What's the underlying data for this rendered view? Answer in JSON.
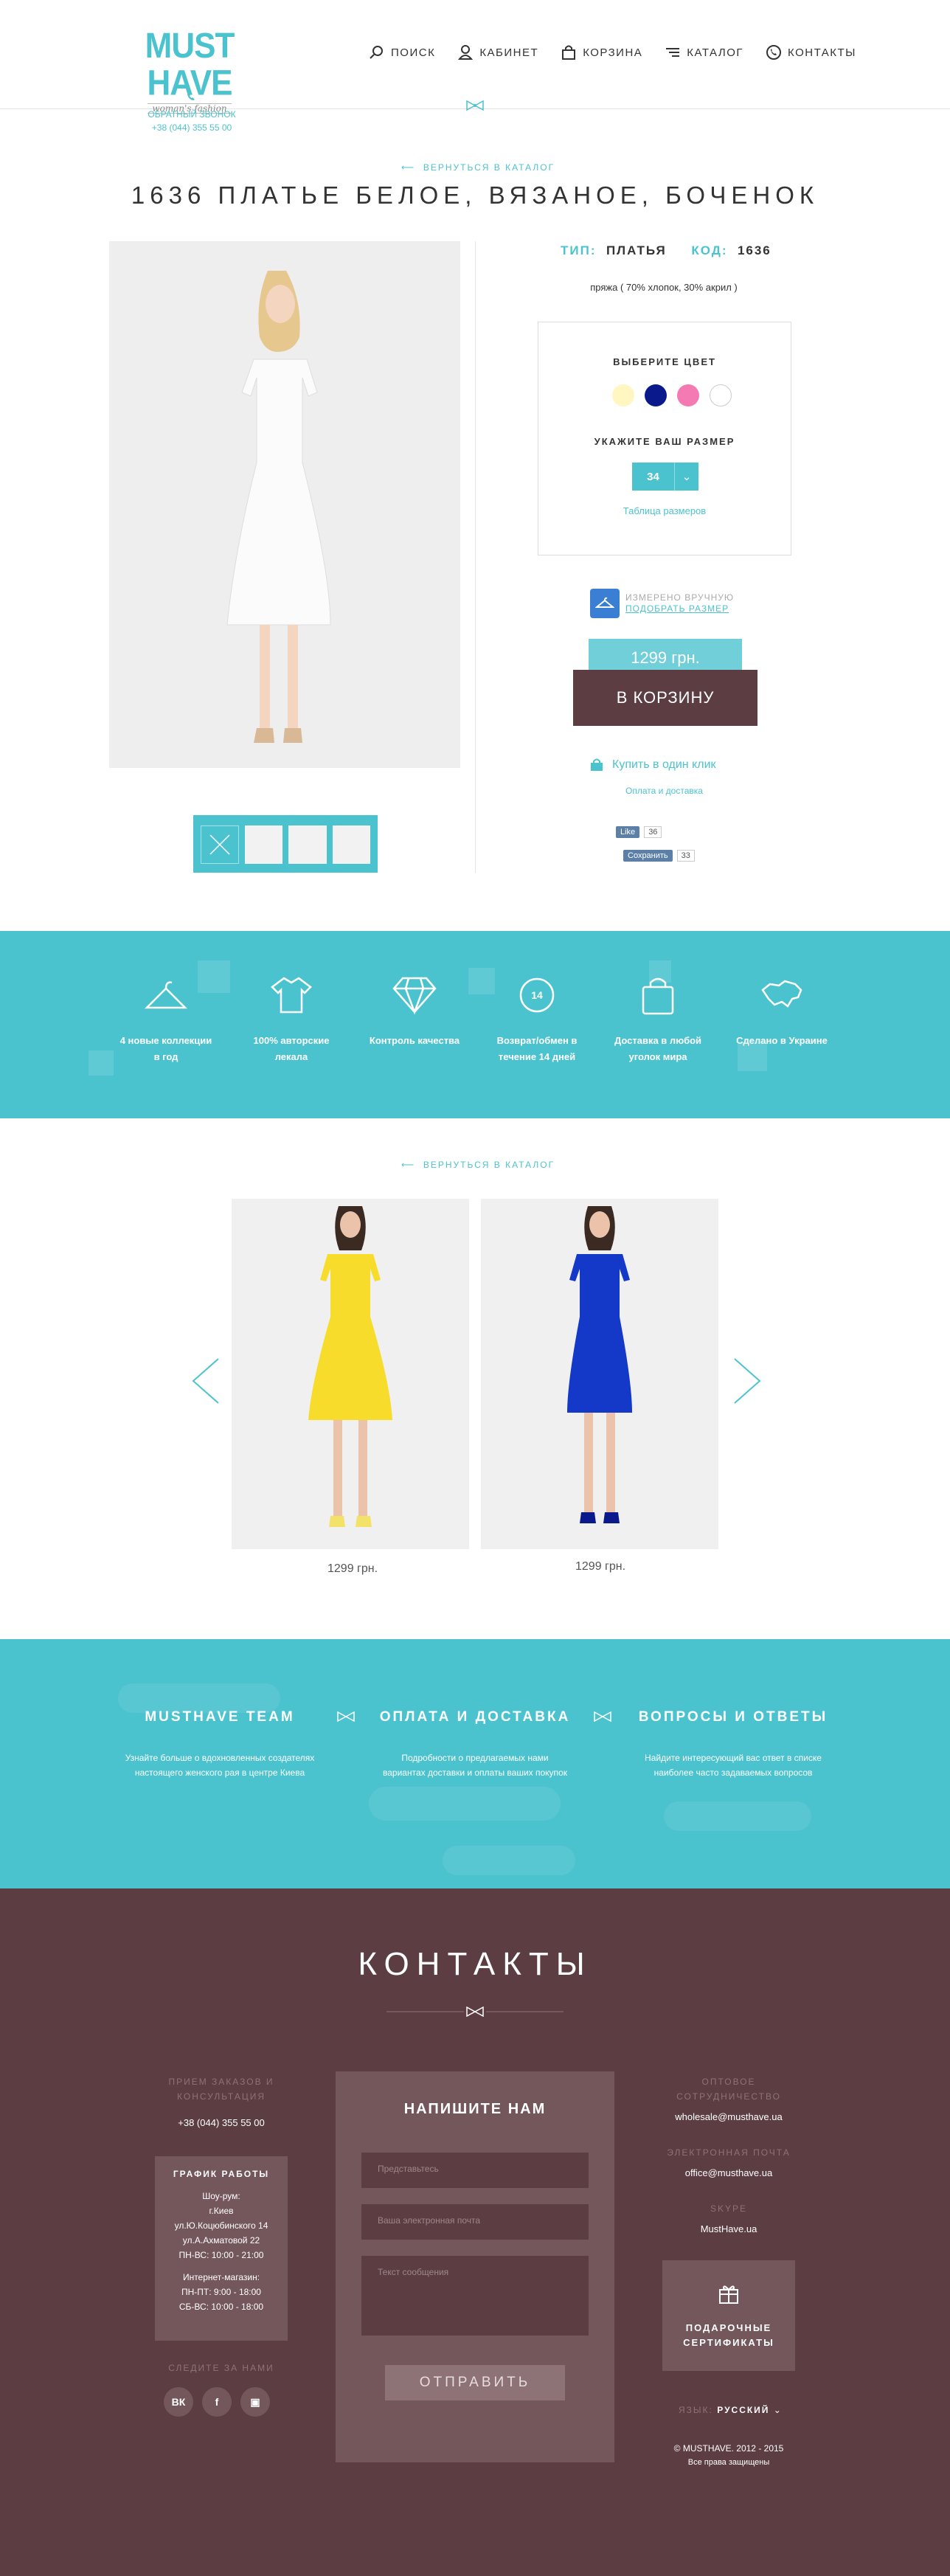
{
  "header": {
    "logo": {
      "main": "MUST HAVE",
      "sub": "woman's fashion"
    },
    "callback": {
      "label": "ОБРАТНЫЙ ЗВОНОК",
      "phone": "+38 (044) 355 55 00"
    },
    "nav": [
      {
        "label": "ПОИСК",
        "icon": "search-icon"
      },
      {
        "label": "КАБИНЕТ",
        "icon": "user-icon"
      },
      {
        "label": "КОРЗИНА",
        "icon": "bag-icon"
      },
      {
        "label": "КАТАЛОГ",
        "icon": "menu-icon"
      },
      {
        "label": "КОНТАКТЫ",
        "icon": "phone-icon"
      }
    ]
  },
  "product": {
    "back_label": "ВЕРНУТЬСЯ В КАТАЛОГ",
    "title": "1636 ПЛАТЬЕ БЕЛОЕ, ВЯЗАНОЕ, БОЧЕНОК",
    "type_label": "ТИП:",
    "type_value": "ПЛАТЬЯ",
    "code_label": "КОД:",
    "code_value": "1636",
    "material": "пряжа ( 70% хлопок, 30% акрил )",
    "color_label": "ВЫБЕРИТЕ ЦВЕТ",
    "colors": [
      "#fff6c2",
      "#0a1a8c",
      "#f47ab4",
      "#ffffff"
    ],
    "size_label": "УКАЖИТЕ ВАШ РАЗМЕР",
    "size_value": "34",
    "size_table": "Таблица размеров",
    "measure_line1": "ИЗМЕРЕНО ВРУЧНУЮ",
    "measure_line2": "ПОДОБРАТЬ РАЗМЕР",
    "price": "1299 грн.",
    "cart": "В КОРЗИНУ",
    "one_click": "Купить в один клик",
    "payment": "Оплата и доставка",
    "vk_like": "Like",
    "vk_count": "36",
    "save_label": "Сохранить",
    "save_count": "33"
  },
  "features": [
    {
      "label": "4 новые коллекции в год",
      "icon": "hanger-icon"
    },
    {
      "label": "100% авторские лекала",
      "icon": "shirt-icon"
    },
    {
      "label": "Контроль качества",
      "icon": "diamond-icon"
    },
    {
      "label": "Возврат/обмен в течение 14 дней",
      "icon": "return-icon",
      "badge": "14"
    },
    {
      "label": "Доставка в любой уголок мира",
      "icon": "shopping-bag-icon"
    },
    {
      "label": "Сделано в Украине",
      "icon": "ukraine-map-icon"
    }
  ],
  "related": {
    "back_label": "ВЕРНУТЬСЯ В КАТАЛОГ",
    "items": [
      {
        "price": "1299 грн.",
        "color": "#f7dc2b"
      },
      {
        "price": "1299 грн.",
        "color": "#1438c8"
      }
    ]
  },
  "info": [
    {
      "title": "MUSTHAVE TEAM",
      "text": "Узнайте больше о вдохновленных создателях настоящего женского рая в центре Киева"
    },
    {
      "title": "ОПЛАТА И ДОСТАВКА",
      "text": "Подробности о предлагаемых нами вариантах доставки и оплаты ваших покупок"
    },
    {
      "title": "ВОПРОСЫ И ОТВЕТЫ",
      "text": "Найдите интересующий вас ответ в списке наиболее часто задаваемых вопросов"
    }
  ],
  "contacts": {
    "title": "КОНТАКТЫ",
    "orders_label": "ПРИЕМ ЗАКАЗОВ И КОНСУЛЬТАЦИЯ",
    "orders_phone": "+38 (044) 355 55 00",
    "schedule": {
      "title": "ГРАФИК РАБОТЫ",
      "lines": [
        "Шоу-рум:",
        "г.Киев",
        "ул.Ю.Коцюбинского 14",
        "ул.А.Ахматовой 22",
        "ПН-ВС: 10:00 - 21:00",
        "",
        "Интернет-магазин:",
        "ПН-ПТ: 9:00 - 18:00",
        "СБ-ВС: 10:00 - 18:00"
      ]
    },
    "follow_label": "СЛЕДИТЕ ЗА НАМИ",
    "social": [
      "ВК",
      "f",
      "▣"
    ],
    "form": {
      "title": "НАПИШИТЕ НАМ",
      "name_placeholder": "Представьтесь",
      "email_placeholder": "Ваша электронная почта",
      "message_placeholder": "Текст сообщения",
      "send": "ОТПРАВИТЬ"
    },
    "wholesale_label": "ОПТОВОЕ СОТРУДНИЧЕСТВО",
    "wholesale_email": "wholesale@musthave.ua",
    "email_label": "ЭЛЕКТРОННАЯ ПОЧТА",
    "email": "office@musthave.ua",
    "skype_label": "SKYPE",
    "skype": "MustHave.ua",
    "gift": "ПОДАРОЧНЫЕ СЕРТИФИКАТЫ",
    "lang_label": "ЯЗЫК:",
    "lang_value": "РУССКИЙ",
    "copyright": "© MUSTHAVE. 2012 - 2015",
    "rights": "Все права защищены"
  }
}
